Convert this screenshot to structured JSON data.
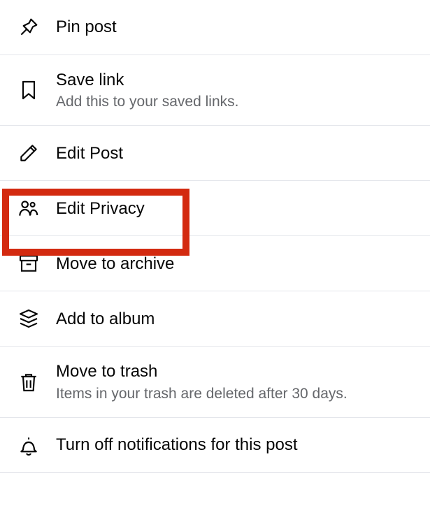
{
  "menu": {
    "items": [
      {
        "icon": "pin-icon",
        "title": "Pin post",
        "subtitle": null
      },
      {
        "icon": "bookmark-icon",
        "title": "Save link",
        "subtitle": "Add this to your saved links."
      },
      {
        "icon": "pencil-icon",
        "title": "Edit Post",
        "subtitle": null
      },
      {
        "icon": "people-icon",
        "title": "Edit Privacy",
        "subtitle": null
      },
      {
        "icon": "archive-icon",
        "title": "Move to archive",
        "subtitle": null
      },
      {
        "icon": "album-icon",
        "title": "Add to album",
        "subtitle": null
      },
      {
        "icon": "trash-icon",
        "title": "Move to trash",
        "subtitle": "Items in your trash are deleted after 30 days."
      },
      {
        "icon": "bell-icon",
        "title": "Turn off notifications for this post",
        "subtitle": null
      }
    ],
    "highlighted_index": 3
  }
}
